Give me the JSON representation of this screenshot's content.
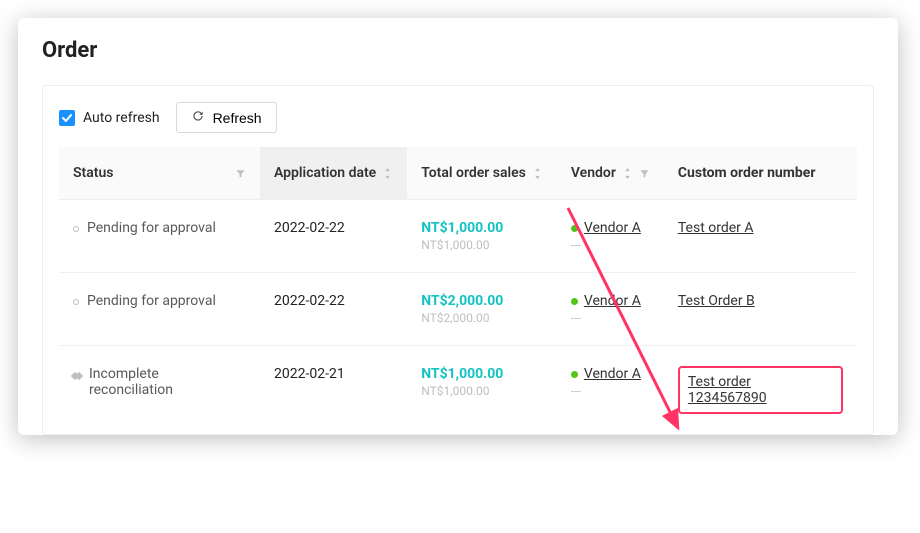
{
  "page": {
    "title": "Order"
  },
  "toolbar": {
    "auto_refresh_label": "Auto refresh",
    "refresh_label": "Refresh"
  },
  "columns": {
    "status": "Status",
    "application_date": "Application date",
    "total_sales": "Total order sales",
    "vendor": "Vendor",
    "custom_order_number": "Custom order number"
  },
  "rows": [
    {
      "status": "Pending for approval",
      "status_kind": "pending",
      "date": "2022-02-22",
      "amount_primary": "NT$1,000.00",
      "amount_secondary": "NT$1,000.00",
      "vendor": "Vendor A",
      "vendor_sub": "---",
      "custom": "Test order A",
      "highlight": false
    },
    {
      "status": "Pending for approval",
      "status_kind": "pending",
      "date": "2022-02-22",
      "amount_primary": "NT$2,000.00",
      "amount_secondary": "NT$2,000.00",
      "vendor": "Vendor A",
      "vendor_sub": "---",
      "custom": "Test Order B",
      "highlight": false
    },
    {
      "status": "Incomplete reconciliation",
      "status_kind": "conflict",
      "date": "2022-02-21",
      "amount_primary": "NT$1,000.00",
      "amount_secondary": "NT$1,000.00",
      "vendor": "Vendor A",
      "vendor_sub": "---",
      "custom": "Test order 1234567890",
      "highlight": true
    }
  ],
  "annotation": {
    "arrow_color": "#ff3366"
  }
}
